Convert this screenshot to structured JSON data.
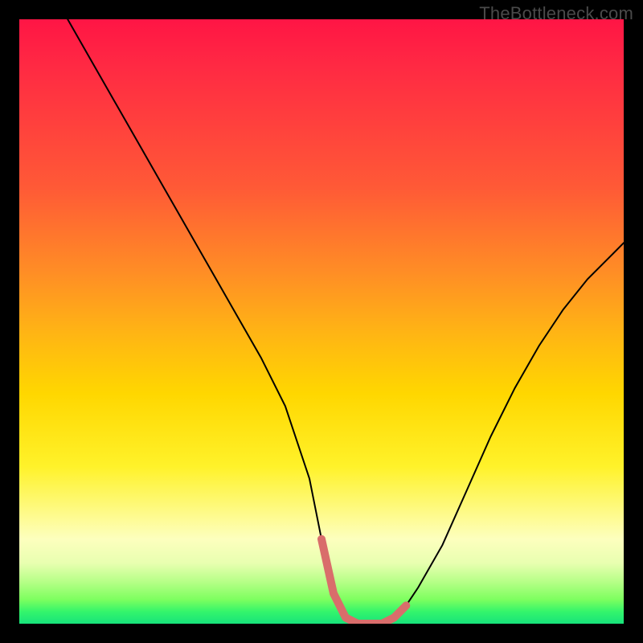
{
  "watermark": "TheBottleneck.com",
  "chart_data": {
    "type": "line",
    "title": "",
    "xlabel": "",
    "ylabel": "",
    "xlim": [
      0,
      100
    ],
    "ylim": [
      0,
      100
    ],
    "grid": false,
    "legend": false,
    "annotations": [],
    "series": [
      {
        "name": "bottleneck-curve",
        "color": "#000000",
        "x": [
          8,
          12,
          16,
          20,
          24,
          28,
          32,
          36,
          40,
          44,
          48,
          50,
          52,
          54,
          56,
          58,
          60,
          62,
          64,
          66,
          70,
          74,
          78,
          82,
          86,
          90,
          94,
          98,
          100
        ],
        "values": [
          100,
          93,
          86,
          79,
          72,
          65,
          58,
          51,
          44,
          36,
          24,
          14,
          5,
          1,
          0,
          0,
          0,
          1,
          3,
          6,
          13,
          22,
          31,
          39,
          46,
          52,
          57,
          61,
          63
        ]
      },
      {
        "name": "optimal-band-highlight",
        "color": "#d96d6b",
        "x": [
          50,
          52,
          54,
          56,
          58,
          60,
          62,
          64
        ],
        "values": [
          14,
          5,
          1,
          0,
          0,
          0,
          1,
          3
        ]
      }
    ],
    "gradient_stops": [
      {
        "pos": 0,
        "color": "#ff1545"
      },
      {
        "pos": 8,
        "color": "#ff2a43"
      },
      {
        "pos": 28,
        "color": "#ff5a36"
      },
      {
        "pos": 42,
        "color": "#ff8e25"
      },
      {
        "pos": 52,
        "color": "#ffb514"
      },
      {
        "pos": 62,
        "color": "#ffd700"
      },
      {
        "pos": 74,
        "color": "#fff22a"
      },
      {
        "pos": 86,
        "color": "#fdffbe"
      },
      {
        "pos": 90,
        "color": "#e8ffb0"
      },
      {
        "pos": 93,
        "color": "#b7ff88"
      },
      {
        "pos": 96,
        "color": "#7dff5f"
      },
      {
        "pos": 98,
        "color": "#34f56b"
      },
      {
        "pos": 100,
        "color": "#17e37a"
      }
    ]
  }
}
